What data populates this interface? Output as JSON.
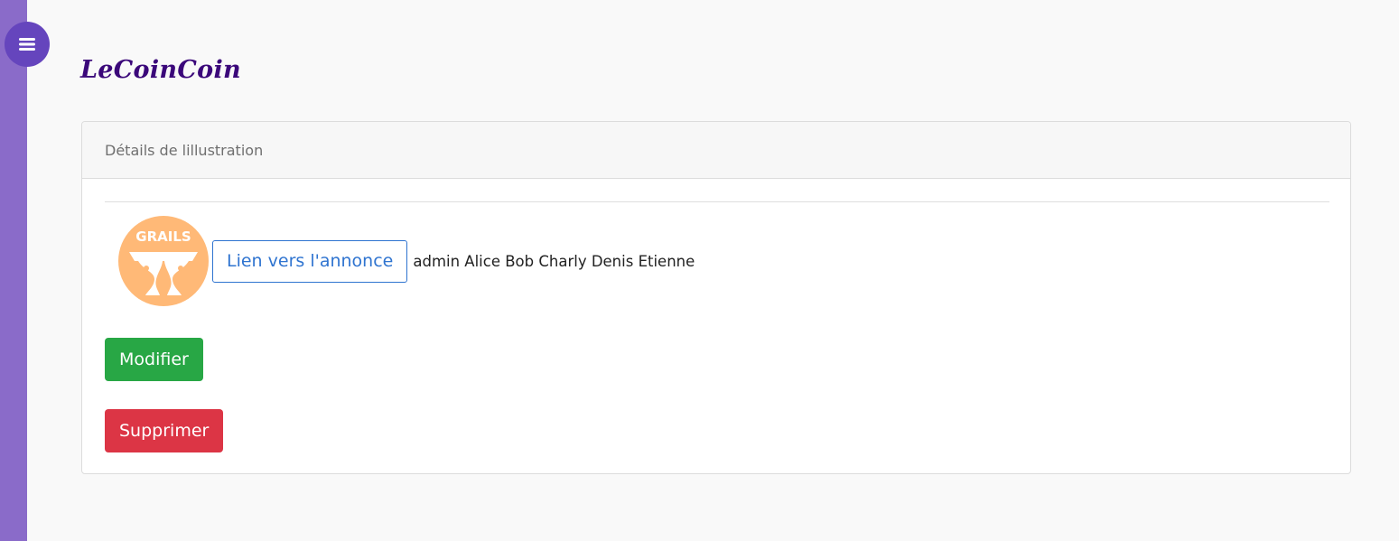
{
  "sidebar": {
    "toggle_icon": "bars-icon",
    "color": "#8a6bc9",
    "toggle_color": "#6545bd"
  },
  "header": {
    "brand": "LeCoinCoin",
    "brand_color": "#3b087a"
  },
  "card": {
    "title": "Détails de lillustration",
    "image": {
      "icon": "grails-logo-icon",
      "text": "GRAILS",
      "color": "#ffb977"
    },
    "link_label": "Lien vers l'annonce",
    "users": "admin Alice Bob Charly Denis Etienne",
    "modify_label": "Modifier",
    "delete_label": "Supprimer"
  },
  "colors": {
    "link": "#2f74d0",
    "success": "#28a745",
    "danger": "#dc3545"
  }
}
